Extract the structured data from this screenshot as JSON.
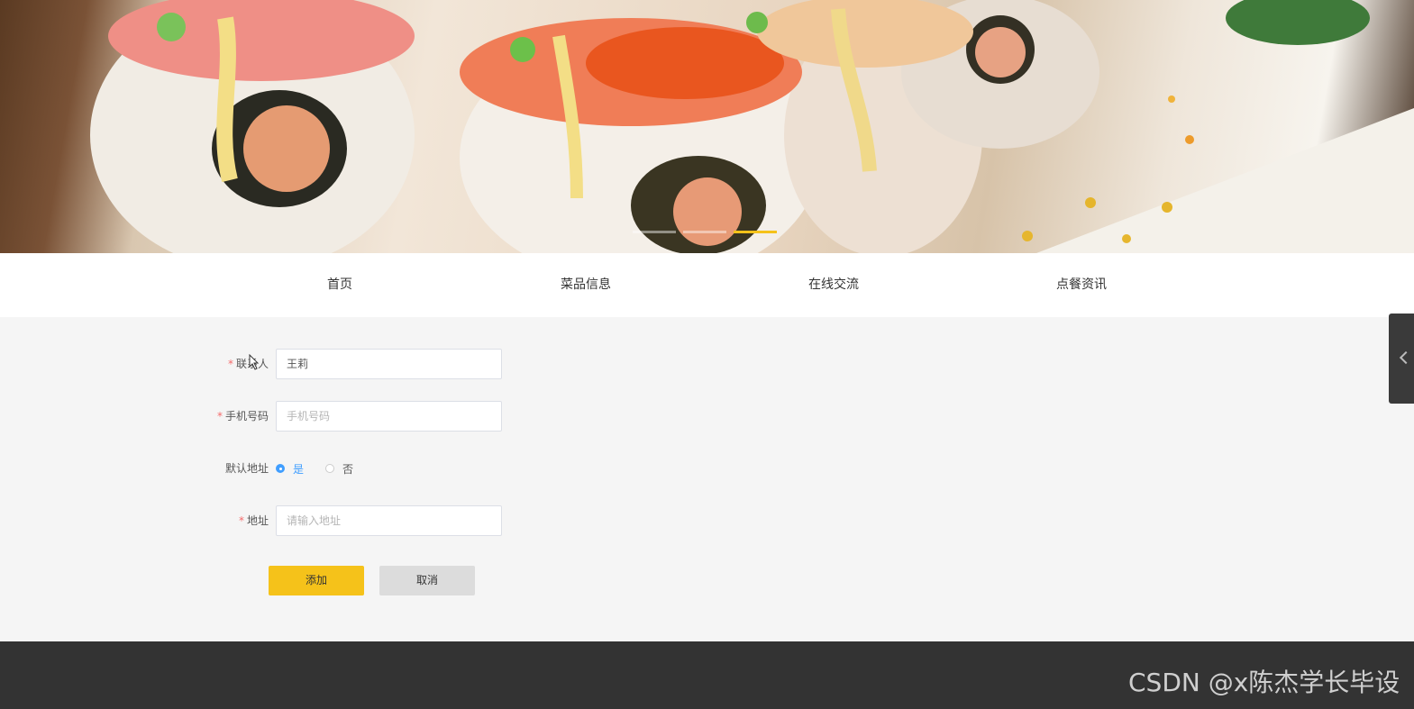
{
  "banner": {
    "image": "sushi-rolls-photo",
    "slides": 3,
    "active_slide": 3
  },
  "nav": {
    "items": [
      {
        "label": "首页"
      },
      {
        "label": "菜品信息"
      },
      {
        "label": "在线交流"
      },
      {
        "label": "点餐资讯"
      }
    ]
  },
  "form": {
    "contact": {
      "label": "联系人",
      "value": "王莉",
      "required": true
    },
    "phone": {
      "label": "手机号码",
      "placeholder": "手机号码",
      "value": "",
      "required": true
    },
    "default_address": {
      "label": "默认地址",
      "options": [
        "是",
        "否"
      ],
      "selected": "是"
    },
    "address": {
      "label": "地址",
      "placeholder": "请输入地址",
      "value": "",
      "required": true
    }
  },
  "buttons": {
    "add": "添加",
    "cancel": "取消"
  },
  "watermark": "CSDN @x陈杰学长毕设",
  "colors": {
    "accent": "#f5c21a",
    "radio": "#409eff",
    "required": "#f56c6c",
    "footer": "#333333"
  }
}
